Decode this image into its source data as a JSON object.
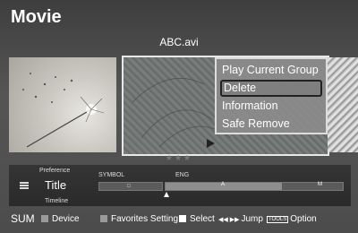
{
  "header": {
    "title": "Movie",
    "filename": "ABC.avi"
  },
  "context_menu": {
    "items": [
      {
        "label": "Play Current Group"
      },
      {
        "label": "Delete"
      },
      {
        "label": "Information"
      },
      {
        "label": "Safe Remove"
      }
    ],
    "selected_index": 1
  },
  "rating": "★★★",
  "timeline_panel": {
    "preference_label": "Preference",
    "title_label": "Title",
    "timeline_label": "Timeline",
    "columns": [
      {
        "label": "SYMBOL",
        "value": "□"
      },
      {
        "label": "ENG",
        "value": "A",
        "end_value": "M"
      }
    ]
  },
  "bottom_bar": {
    "sum_label": "SUM",
    "device_label": "Device",
    "favorites_label": "Favorites Setting",
    "select_label": "Select",
    "jump_icon": "◀◀ ▶▶",
    "jump_label": "Jump",
    "tools_icon": "TOOLS",
    "option_label": "Option"
  }
}
